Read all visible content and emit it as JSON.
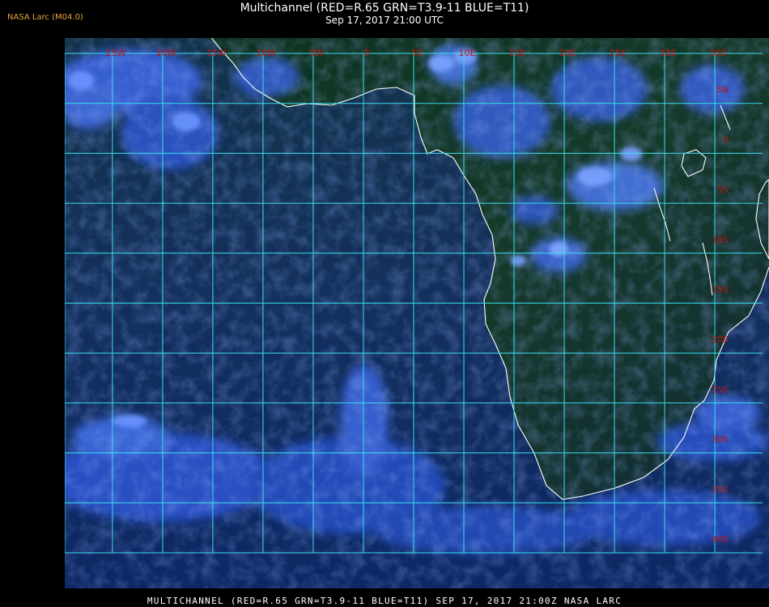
{
  "header": {
    "logo": "NASA Larc (M04.0)",
    "title": "Multichannel (RED=R.65 GRN=T3.9-11 BLUE=T11)",
    "datetime": "Sep 17, 2017 21:00 UTC"
  },
  "map": {
    "longitude_labels": [
      "25W",
      "20W",
      "15W",
      "10W",
      "5W",
      "0",
      "5E",
      "10E",
      "15E",
      "20E",
      "25E",
      "30E",
      "35E"
    ],
    "latitude_labels": [
      "5N",
      "0",
      "5S",
      "10S",
      "15S",
      "20S",
      "25S",
      "30S",
      "35S",
      "40S"
    ],
    "grid_color": "#38e0f0",
    "label_color": "#c41010",
    "coast_color": "#ffffff",
    "colors": {
      "ocean_deep": "#0d2459",
      "ocean": "#173a8c",
      "land": "#12331f",
      "cloud": "#3b64e0",
      "cloud_bright": "#6b98ff"
    }
  },
  "footer": {
    "caption": "MULTICHANNEL (RED=R.65 GRN=T3.9-11 BLUE=T11) SEP 17, 2017 21:00Z   NASA LARC"
  }
}
